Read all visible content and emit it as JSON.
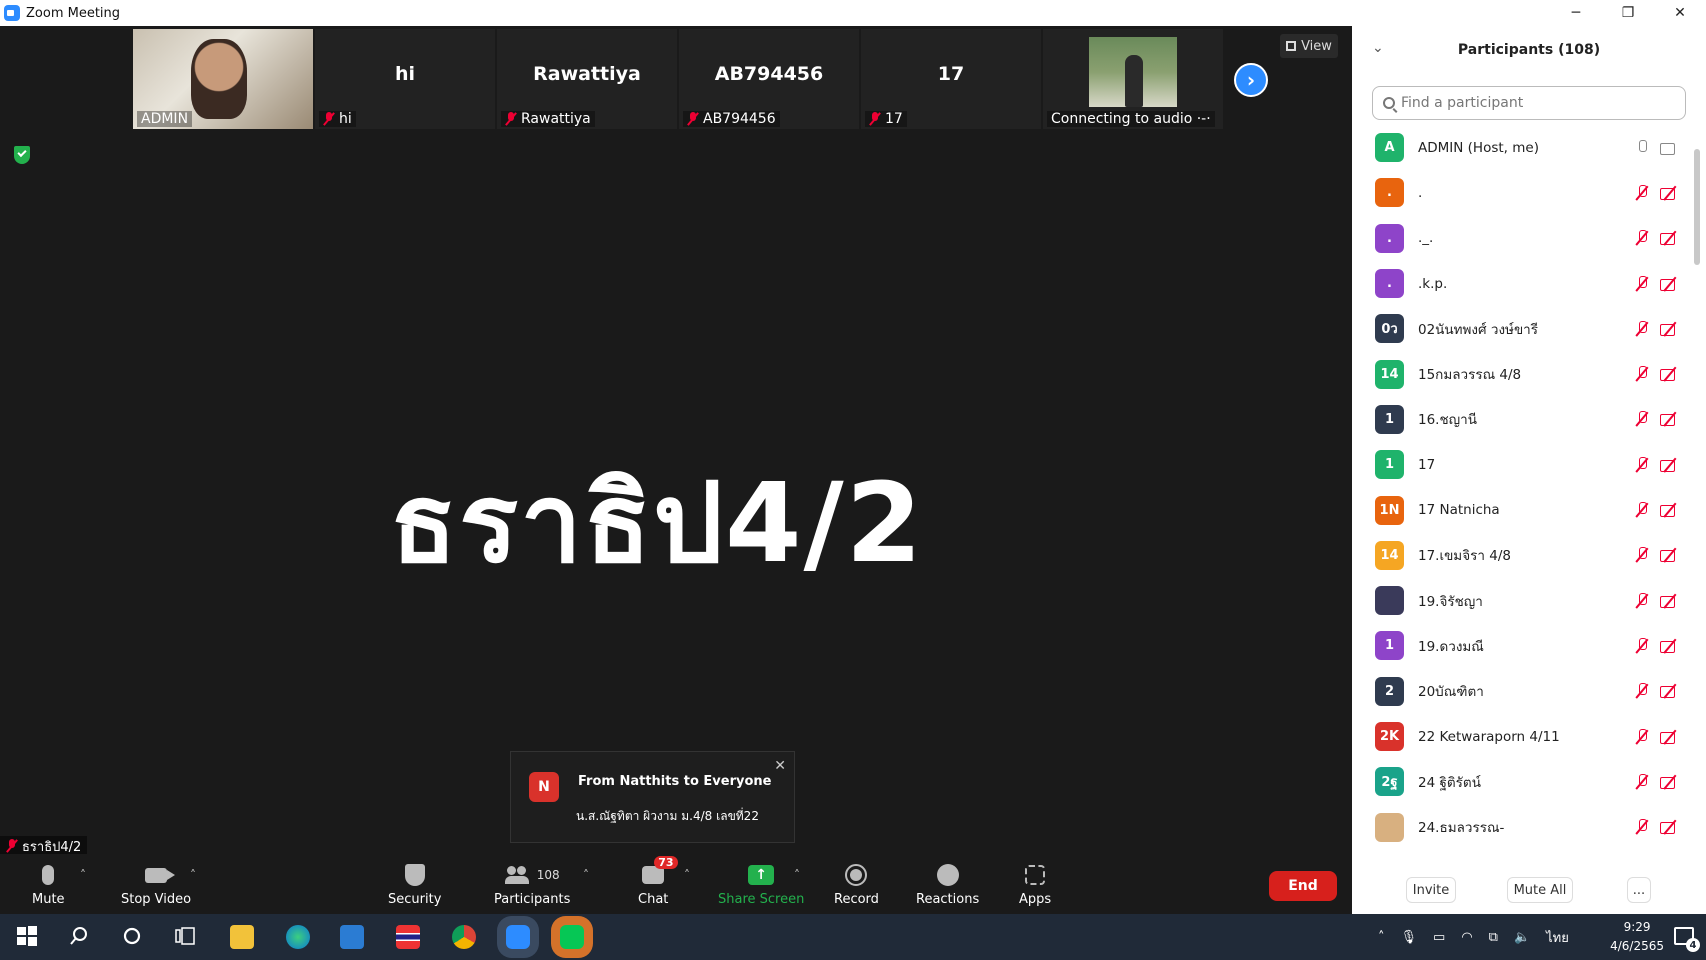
{
  "window": {
    "title": "Zoom Meeting",
    "controls": {
      "minimize": "─",
      "restore": "❐",
      "close": "✕"
    }
  },
  "gallery": {
    "tiles": [
      {
        "label": "ADMIN",
        "display": "",
        "muted": false,
        "kind": "video"
      },
      {
        "label": "hi",
        "display": "hi",
        "muted": true,
        "kind": "name"
      },
      {
        "label": "Rawattiya",
        "display": "Rawattiya",
        "muted": true,
        "kind": "name"
      },
      {
        "label": "AB794456",
        "display": "AB794456",
        "muted": true,
        "kind": "name"
      },
      {
        "label": "17",
        "display": "17",
        "muted": true,
        "kind": "name"
      },
      {
        "label": "Connecting to audio ·-·",
        "display": "",
        "muted": false,
        "kind": "video"
      }
    ],
    "next_icon": "›",
    "view_label": "View"
  },
  "main": {
    "active_speaker_display": "ธราธิป4/2",
    "active_speaker_label": "ธราธิป4/2"
  },
  "chat_toast": {
    "avatar": "N",
    "title": "From Natthits to Everyone",
    "message": "น.ส.ณัฐทิตา ผิวงาม ม.4/8 เลขที่22",
    "close": "✕"
  },
  "toolbar": {
    "mute": "Mute",
    "stop_video": "Stop Video",
    "security": "Security",
    "participants": "Participants",
    "participants_count": "108",
    "chat": "Chat",
    "chat_badge": "73",
    "share_screen": "Share Screen",
    "record": "Record",
    "reactions": "Reactions",
    "apps": "Apps",
    "end": "End",
    "caret": "˄",
    "share_arrow": "↑"
  },
  "colors": {
    "accent_blue": "#2d8cff",
    "share_green": "#23b14d",
    "end_red": "#d7201c",
    "muted_red": "#e00033"
  },
  "participants_panel": {
    "title": "Participants (108)",
    "collapse_icon": "⌄",
    "search_placeholder": "Find a participant",
    "invite": "Invite",
    "mute_all": "Mute All",
    "more": "...",
    "list": [
      {
        "initials": "A",
        "name": "ADMIN (Host, me)",
        "color": "#1fb36b",
        "muted": false
      },
      {
        "initials": ".",
        "name": ".",
        "color": "#e8640e",
        "muted": true
      },
      {
        "initials": ".",
        "name": "._.",
        "color": "#8e44c9",
        "muted": true
      },
      {
        "initials": ".",
        "name": ".k.p.",
        "color": "#8e44c9",
        "muted": true
      },
      {
        "initials": "0ว",
        "name": "02นันทพงศ์ วงษ์ขารี",
        "color": "#2f3b4f",
        "muted": true
      },
      {
        "initials": "14",
        "name": "15กมลวรรณ 4/8",
        "color": "#1fb36b",
        "muted": true
      },
      {
        "initials": "1",
        "name": "16.ชญานี",
        "color": "#2f3b4f",
        "muted": true
      },
      {
        "initials": "1",
        "name": "17",
        "color": "#1fb36b",
        "muted": true
      },
      {
        "initials": "1N",
        "name": "17 Natnicha",
        "color": "#e8640e",
        "muted": true
      },
      {
        "initials": "14",
        "name": "17.เขมจิรา 4/8",
        "color": "#f5a623",
        "muted": true
      },
      {
        "initials": "",
        "name": "19.จิรัชญา",
        "color": "#3a3a5a",
        "muted": true
      },
      {
        "initials": "1",
        "name": "19.ดวงมณี",
        "color": "#8e44c9",
        "muted": true
      },
      {
        "initials": "2",
        "name": "20บัณฑิตา",
        "color": "#2f3b4f",
        "muted": true
      },
      {
        "initials": "2K",
        "name": "22 Ketwaraporn 4/11",
        "color": "#d9322b",
        "muted": true
      },
      {
        "initials": "2ฐ",
        "name": "24 ฐิติรัตน์",
        "color": "#1aa38a",
        "muted": true
      },
      {
        "initials": "",
        "name": "24.ธมลวรรณ-",
        "color": "#d8b080",
        "muted": true
      }
    ]
  },
  "taskbar": {
    "language": "ไทย",
    "time": "9:29",
    "date": "4/6/2565",
    "notification_count": "4"
  }
}
